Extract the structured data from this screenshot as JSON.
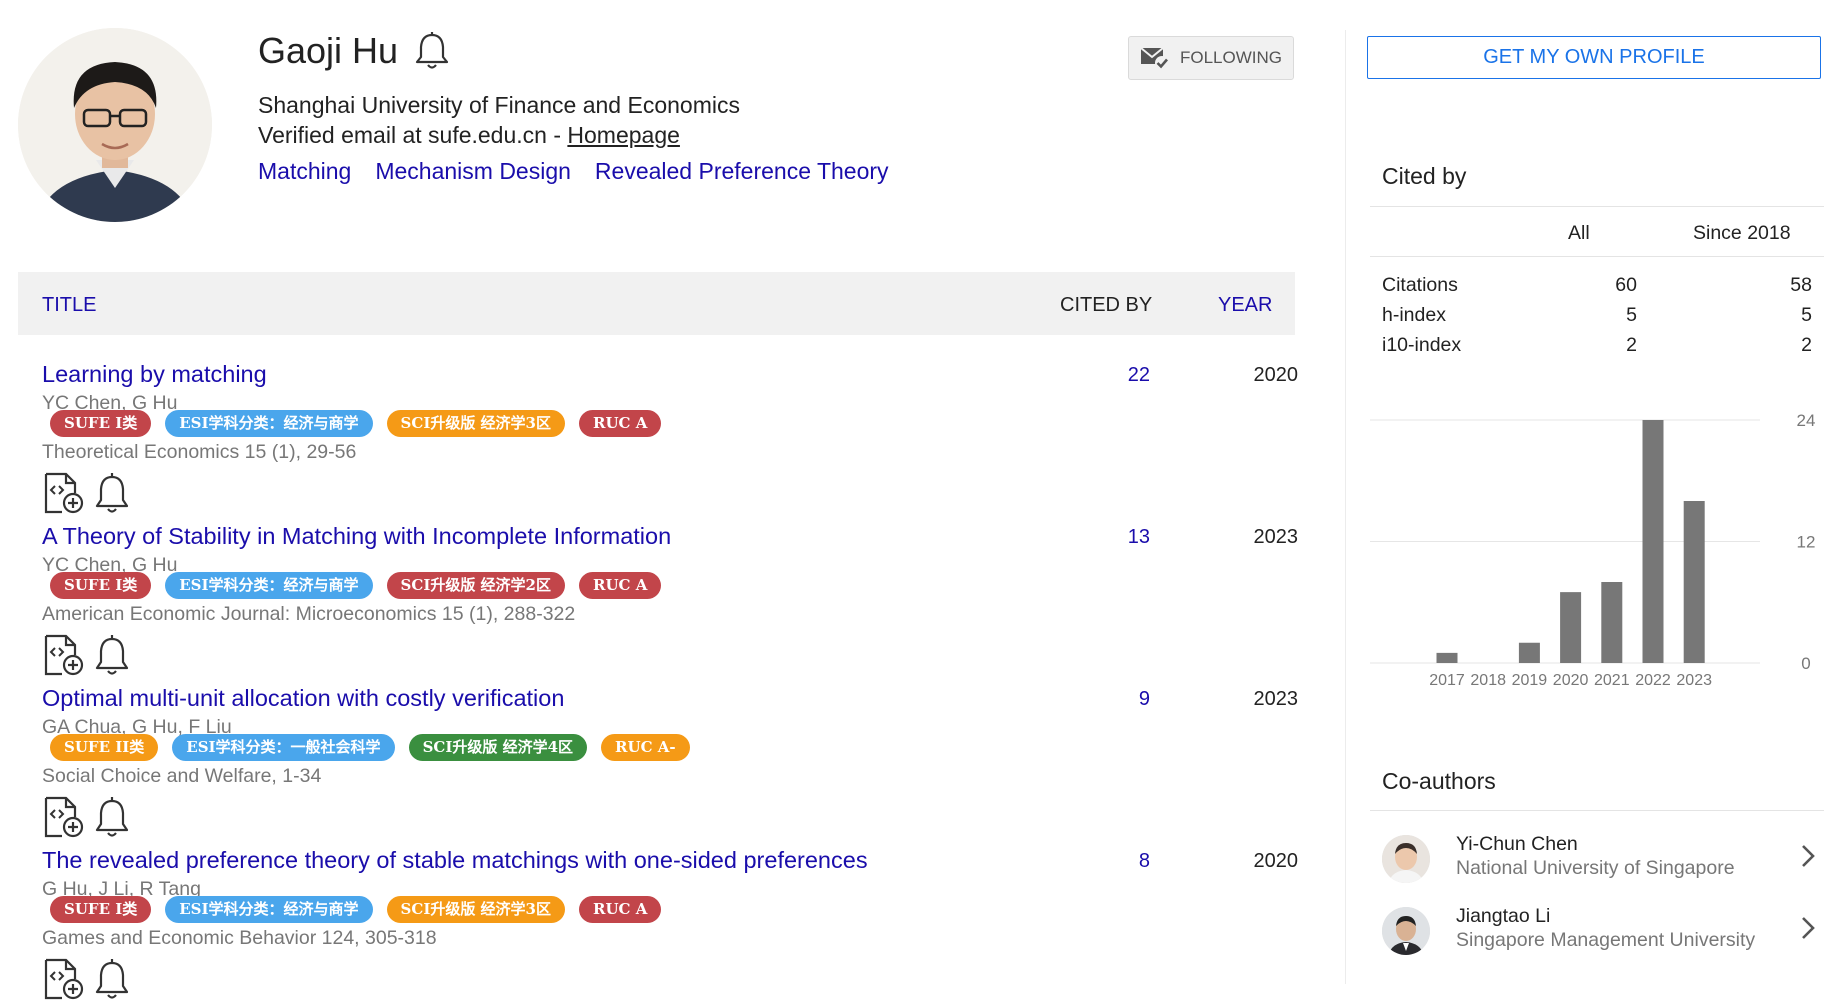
{
  "profile": {
    "name": "Gaoji Hu",
    "affiliation": "Shanghai University of Finance and Economics",
    "email_text": "Verified email at sufe.edu.cn - ",
    "homepage_label": "Homepage",
    "interests": [
      "Matching",
      "Mechanism Design",
      "Revealed Preference Theory"
    ],
    "follow_label": "FOLLOWING"
  },
  "table": {
    "col_title": "TITLE",
    "col_cited": "CITED BY",
    "col_year": "YEAR"
  },
  "publications": [
    {
      "title": "Learning by matching",
      "authors": "YC Chen, G Hu",
      "badges": [
        {
          "text": "SUFE I类",
          "color": "#c2454a"
        },
        {
          "text": "ESI学科分类：经济与商学",
          "color": "#4aa6ec"
        },
        {
          "text": "SCI升级版 经济学3区",
          "color": "#f59a16"
        },
        {
          "text": "RUC A",
          "color": "#c2454a"
        }
      ],
      "venue": "Theoretical Economics 15 (1), 29-56",
      "cited": "22",
      "year": "2020"
    },
    {
      "title": "A Theory of Stability in Matching with Incomplete Information",
      "authors": "YC Chen, G Hu",
      "badges": [
        {
          "text": "SUFE I类",
          "color": "#c2454a"
        },
        {
          "text": "ESI学科分类：经济与商学",
          "color": "#4aa6ec"
        },
        {
          "text": "SCI升级版 经济学2区",
          "color": "#c2454a"
        },
        {
          "text": "RUC A",
          "color": "#c2454a"
        }
      ],
      "venue": "American Economic Journal: Microeconomics 15 (1), 288-322",
      "cited": "13",
      "year": "2023"
    },
    {
      "title": "Optimal multi-unit allocation with costly verification",
      "authors": "GA Chua, G Hu, F Liu",
      "badges": [
        {
          "text": "SUFE II类",
          "color": "#f59a16"
        },
        {
          "text": "ESI学科分类：一般社会科学",
          "color": "#4aa6ec"
        },
        {
          "text": "SCI升级版 经济学4区",
          "color": "#3a8f3f"
        },
        {
          "text": "RUC A-",
          "color": "#f59a16"
        }
      ],
      "venue": "Social Choice and Welfare, 1-34",
      "cited": "9",
      "year": "2023"
    },
    {
      "title": "The revealed preference theory of stable matchings with one-sided preferences",
      "authors": "G Hu, J Li, R Tang",
      "badges": [
        {
          "text": "SUFE I类",
          "color": "#c2454a"
        },
        {
          "text": "ESI学科分类：经济与商学",
          "color": "#4aa6ec"
        },
        {
          "text": "SCI升级版 经济学3区",
          "color": "#f59a16"
        },
        {
          "text": "RUC A",
          "color": "#c2454a"
        }
      ],
      "venue": "Games and Economic Behavior 124, 305-318",
      "cited": "8",
      "year": "2020"
    }
  ],
  "sidebar": {
    "own_profile_label": "GET MY OWN PROFILE",
    "cited_by_title": "Cited by",
    "col_all": "All",
    "col_since": "Since 2018",
    "metrics": [
      {
        "label": "Citations",
        "all": "60",
        "since": "58"
      },
      {
        "label": "h-index",
        "all": "5",
        "since": "5"
      },
      {
        "label": "i10-index",
        "all": "2",
        "since": "2"
      }
    ],
    "coauthors_title": "Co-authors",
    "coauthors": [
      {
        "name": "Yi-Chun Chen",
        "affiliation": "National University of Singapore"
      },
      {
        "name": "Jiangtao Li",
        "affiliation": "Singapore Management University"
      }
    ]
  },
  "chart_data": {
    "type": "bar",
    "categories": [
      "2017",
      "2018",
      "2019",
      "2020",
      "2021",
      "2022",
      "2023"
    ],
    "values": [
      1,
      0,
      2,
      7,
      8,
      24,
      16
    ],
    "yticks": [
      0,
      12,
      24
    ],
    "ylim": [
      0,
      24
    ],
    "bar_color": "#777777",
    "grid": true
  }
}
